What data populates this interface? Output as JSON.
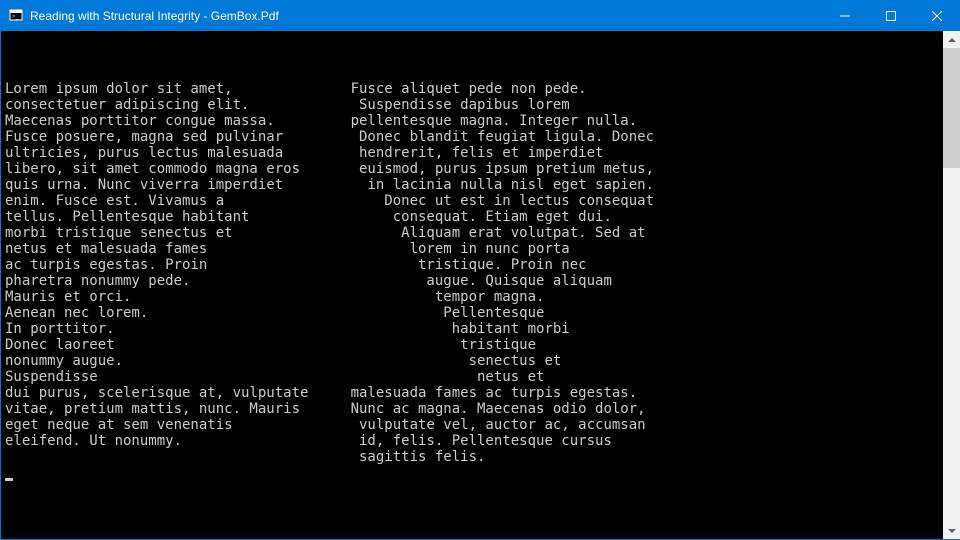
{
  "window": {
    "title": "Reading with Structural Integrity - GemBox.Pdf"
  },
  "console": {
    "lines": [
      "Lorem ipsum dolor sit amet,              Fusce aliquet pede non pede.",
      "consectetuer adipiscing elit.             Suspendisse dapibus lorem",
      "Maecenas porttitor congue massa.         pellentesque magna. Integer nulla.",
      "Fusce posuere, magna sed pulvinar         Donec blandit feugiat ligula. Donec",
      "ultricies, purus lectus malesuada         hendrerit, felis et imperdiet",
      "libero, sit amet commodo magna eros       euismod, purus ipsum pretium metus,",
      "quis urna. Nunc viverra imperdiet          in lacinia nulla nisl eget sapien.",
      "enim. Fusce est. Vivamus a                   Donec ut est in lectus consequat",
      "tellus. Pellentesque habitant                 consequat. Etiam eget dui.",
      "morbi tristique senectus et                    Aliquam erat volutpat. Sed at",
      "netus et malesuada fames                        lorem in nunc porta",
      "ac turpis egestas. Proin                         tristique. Proin nec",
      "pharetra nonummy pede.                            augue. Quisque aliquam",
      "Mauris et orci.                                    tempor magna.",
      "Aenean nec lorem.                                   Pellentesque",
      "In porttitor.                                        habitant morbi",
      "Donec laoreet                                         tristique",
      "nonummy augue.                                         senectus et",
      "Suspendisse                                             netus et",
      "dui purus, scelerisque at, vulputate     malesuada fames ac turpis egestas.",
      "vitae, pretium mattis, nunc. Mauris      Nunc ac magna. Maecenas odio dolor,",
      "eget neque at sem venenatis               vulputate vel, auctor ac, accumsan",
      "eleifend. Ut nonummy.                     id, felis. Pellentesque cursus",
      "                                          sagittis felis."
    ]
  }
}
